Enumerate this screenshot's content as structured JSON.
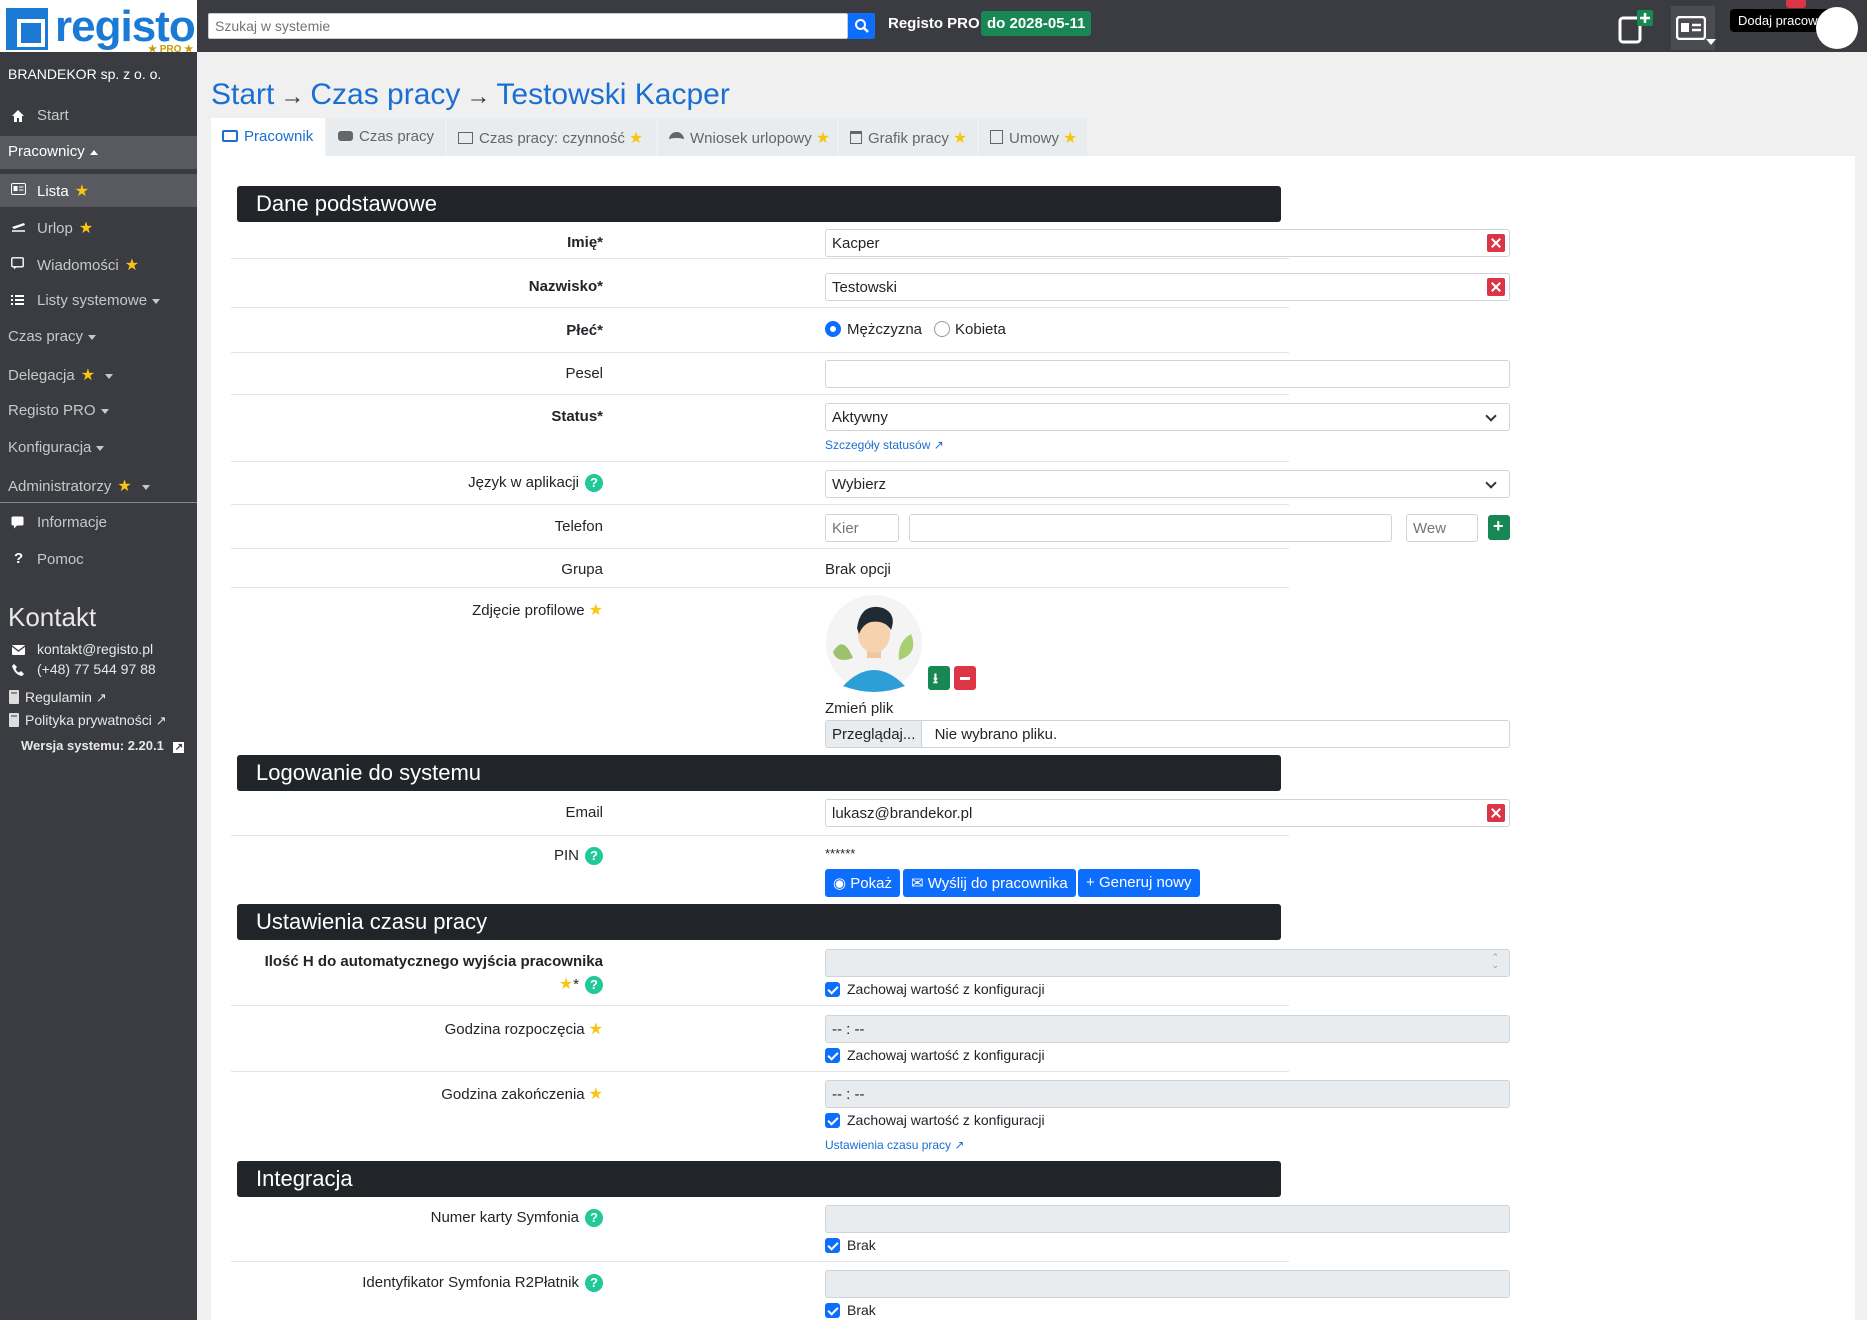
{
  "brand": {
    "logo_text": "registo",
    "logo_badge": "★ PRO ★",
    "company": "BRANDEKOR sp. z o. o."
  },
  "topbar": {
    "search_placeholder": "Szukaj w systemie",
    "plan_label": "Registo PRO",
    "plan_badge": "do 2028-05-11",
    "tooltip": "Dodaj pracownika"
  },
  "sidebar": {
    "items": [
      {
        "label": "Start",
        "icon": "home-icon"
      },
      {
        "label": "Pracownicy"
      },
      {
        "label": "Lista",
        "icon": "id-card-icon"
      },
      {
        "label": "Urlop",
        "icon": "plane-icon"
      },
      {
        "label": "Wiadomości",
        "icon": "message-icon"
      },
      {
        "label": "Listy systemowe",
        "icon": "list-icon"
      },
      {
        "label": "Czas pracy"
      },
      {
        "label": "Delegacja"
      },
      {
        "label": "Registo PRO"
      },
      {
        "label": "Konfiguracja"
      },
      {
        "label": "Administratorzy"
      },
      {
        "label": "Informacje",
        "icon": "chat-icon"
      },
      {
        "label": "Pomoc",
        "icon": "question-icon"
      }
    ],
    "contact_title": "Kontakt",
    "email": "kontakt@registo.pl",
    "phone": "(+48) 77 544 97 88",
    "regulamin": "Regulamin",
    "privacy": "Polityka prywatności",
    "version": "Wersja systemu: 2.20.1"
  },
  "breadcrumb": [
    "Start",
    "Czas pracy",
    "Testowski Kacper"
  ],
  "tabs": [
    {
      "label": "Pracownik",
      "active": true
    },
    {
      "label": "Czas pracy"
    },
    {
      "label": "Czas pracy: czynność"
    },
    {
      "label": "Wniosek urlopowy"
    },
    {
      "label": "Grafik pracy"
    },
    {
      "label": "Umowy"
    }
  ],
  "sections": {
    "basic": "Dane podstawowe",
    "login": "Logowanie do systemu",
    "worktime": "Ustawienia czasu pracy",
    "integration": "Integracja"
  },
  "form": {
    "first_name": {
      "label": "Imię*",
      "value": "Kacper"
    },
    "last_name": {
      "label": "Nazwisko*",
      "value": "Testowski"
    },
    "gender": {
      "label": "Płeć*",
      "male": "Mężczyzna",
      "female": "Kobieta",
      "selected": "Mężczyzna"
    },
    "pesel": {
      "label": "Pesel",
      "value": ""
    },
    "status": {
      "label": "Status*",
      "value": "Aktywny",
      "link": "Szczegóły statusów"
    },
    "language": {
      "label": "Język w aplikacji",
      "value": "Wybierz"
    },
    "phone": {
      "label": "Telefon",
      "area_placeholder": "Kier",
      "ext_placeholder": "Wew"
    },
    "group": {
      "label": "Grupa",
      "value": "Brak opcji"
    },
    "photo": {
      "label": "Zdjęcie profilowe",
      "change": "Zmień plik",
      "browse": "Przeglądaj...",
      "no_file": "Nie wybrano pliku."
    },
    "email": {
      "label": "Email",
      "value": "lukasz@brandekor.pl"
    },
    "pin": {
      "label": "PIN",
      "value": "******",
      "show": "Pokaż",
      "send": "Wyślij do pracownika",
      "generate": "Generuj nowy"
    },
    "auto_exit": {
      "label": "Ilość H do automatycznego wyjścia pracownika",
      "keep": "Zachowaj wartość z konfiguracji"
    },
    "start_time": {
      "label": "Godzina rozpoczęcia",
      "value": "-- : --",
      "keep": "Zachowaj wartość z konfiguracji"
    },
    "end_time": {
      "label": "Godzina zakończenia",
      "value": "-- : --",
      "keep": "Zachowaj wartość z konfiguracji",
      "link": "Ustawienia czasu pracy"
    },
    "symfonia_card": {
      "label": "Numer karty Symfonia",
      "none": "Brak"
    },
    "symfonia_id": {
      "label": "Identyfikator Symfonia R2Płatnik",
      "none": "Brak"
    }
  },
  "colors": {
    "accent": "#1a6fd1",
    "primary": "#0d6efd",
    "success": "#198754",
    "danger": "#dc3545",
    "sidebar": "#3a3c42"
  }
}
